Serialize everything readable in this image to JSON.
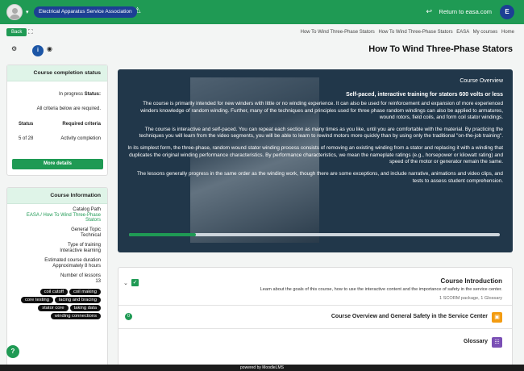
{
  "topbar": {
    "brand_label": "E",
    "return_label": "Return to easa.com",
    "association_label": "Electrical Apparatus Service Association"
  },
  "nav": {
    "back_label": "Back",
    "breadcrumb": [
      "Home",
      "My courses",
      "EASA",
      "How To Wind Three-Phase Stators",
      "How To Wind Three-Phase Stators"
    ]
  },
  "page": {
    "title": "How To Wind Three-Phase Stators"
  },
  "completion": {
    "title": "Course completion status",
    "status_label": "Status:",
    "status_value": "In progress",
    "all_required": "All criteria below are required.",
    "col_criteria": "Required criteria",
    "col_status": "Status",
    "criteria_name": "Activity completion",
    "criteria_status": "5 of 28",
    "more_details_label": "More details"
  },
  "course_info": {
    "title": "Course Information",
    "catalog_path_label": "Catalog Path",
    "catalog_path_value": "EASA / How To Wind Three-Phase Stators",
    "general_topic_label": "General Topic",
    "general_topic_value": "Technical",
    "training_type_label": "Type of training",
    "training_type_value": "Interactive learning",
    "duration_label": "Estimated course duration",
    "duration_value": "Approximately 8 hours",
    "lessons_label": "Number of lessons",
    "lessons_value": "13",
    "tags": [
      "coil cutoff",
      "coil making",
      "core testing",
      "lacing and bracing",
      "stator core",
      "taking data",
      "winding connections"
    ]
  },
  "hero": {
    "overview_title": "Course Overview",
    "subtitle": "Self-paced, interactive training for stators 600 volts or less",
    "p1": "The course is primarily intended for new winders with little or no winding experience. It can also be used for reinforcement and expansion of more experienced winders knowledge of random winding. Further, many of the techniques and principles used for three phase random windings can also be applied to armatures, wound rotors, field coils, and form coil stator windings.",
    "p2": "The course is interactive and self-paced. You can repeat each section as many times as you like, until you are comfortable with the material. By practicing the techniques you will learn from the video segments, you will be able to learn to rewind motors more quickly than by using only the traditional \"on-the-job training\".",
    "p3": "In its simplest form, the three-phase, random wound stator winding process consists of removing an existing winding from a stator and replacing it with a winding that duplicates the original winding performance characteristics. By performance characteristics, we mean the nameplate ratings (e.g., horsepower or kilowatt rating) and speed of the motor or generator remain the same.",
    "p4": "The lessons generally progress in the same order as the winding work, though there are some exceptions, and include narrative, animations and video clips, and tests to assess student comprehension.",
    "progress": 0.18
  },
  "sections": {
    "intro_title": "Course Introduction",
    "intro_desc": "Learn about the goals of this course, how to use the interactive content and the importance of safety in the service center.",
    "scorm": "1 SCORM package, 1 Glossary",
    "overview_safety": "Course Overview and General Safety in the Service Center",
    "overview_badge": "0",
    "glossary": "Glossary"
  },
  "footer": {
    "label": "powered by MoodleLMS"
  }
}
